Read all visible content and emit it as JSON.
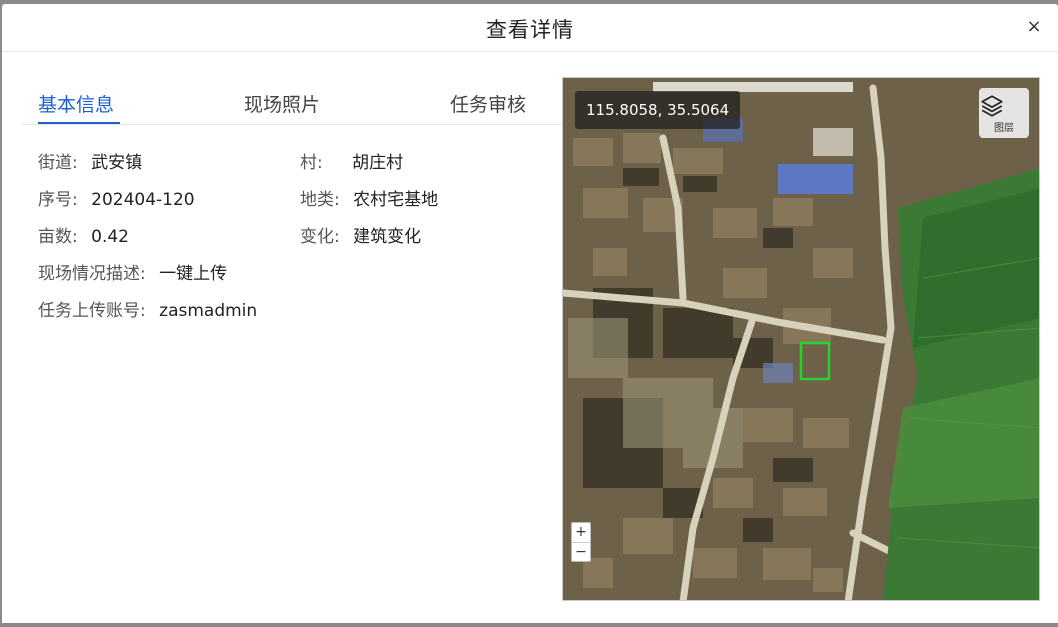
{
  "dialog": {
    "title": "查看详情",
    "close_label": "×"
  },
  "tabs": [
    {
      "label": "基本信息",
      "active": true
    },
    {
      "label": "现场照片",
      "active": false
    },
    {
      "label": "任务审核",
      "active": false
    }
  ],
  "info": {
    "street": {
      "label": "街道:",
      "value": "武安镇"
    },
    "village": {
      "label": "村:",
      "value": "胡庄村"
    },
    "serial": {
      "label": "序号:",
      "value": "202404-120"
    },
    "land_type": {
      "label": "地类:",
      "value": "农村宅基地"
    },
    "area": {
      "label": "亩数:",
      "value": "0.42"
    },
    "change": {
      "label": "变化:",
      "value": "建筑变化"
    },
    "description": {
      "label": "现场情况描述:",
      "value": "一键上传"
    },
    "account": {
      "label": "任务上传账号:",
      "value": "zasmadmin"
    }
  },
  "map": {
    "coordinates": "115.8058, 35.5064",
    "layer_label": "图层",
    "zoom_in": "+",
    "zoom_out": "−",
    "highlight_color": "#27d327"
  }
}
